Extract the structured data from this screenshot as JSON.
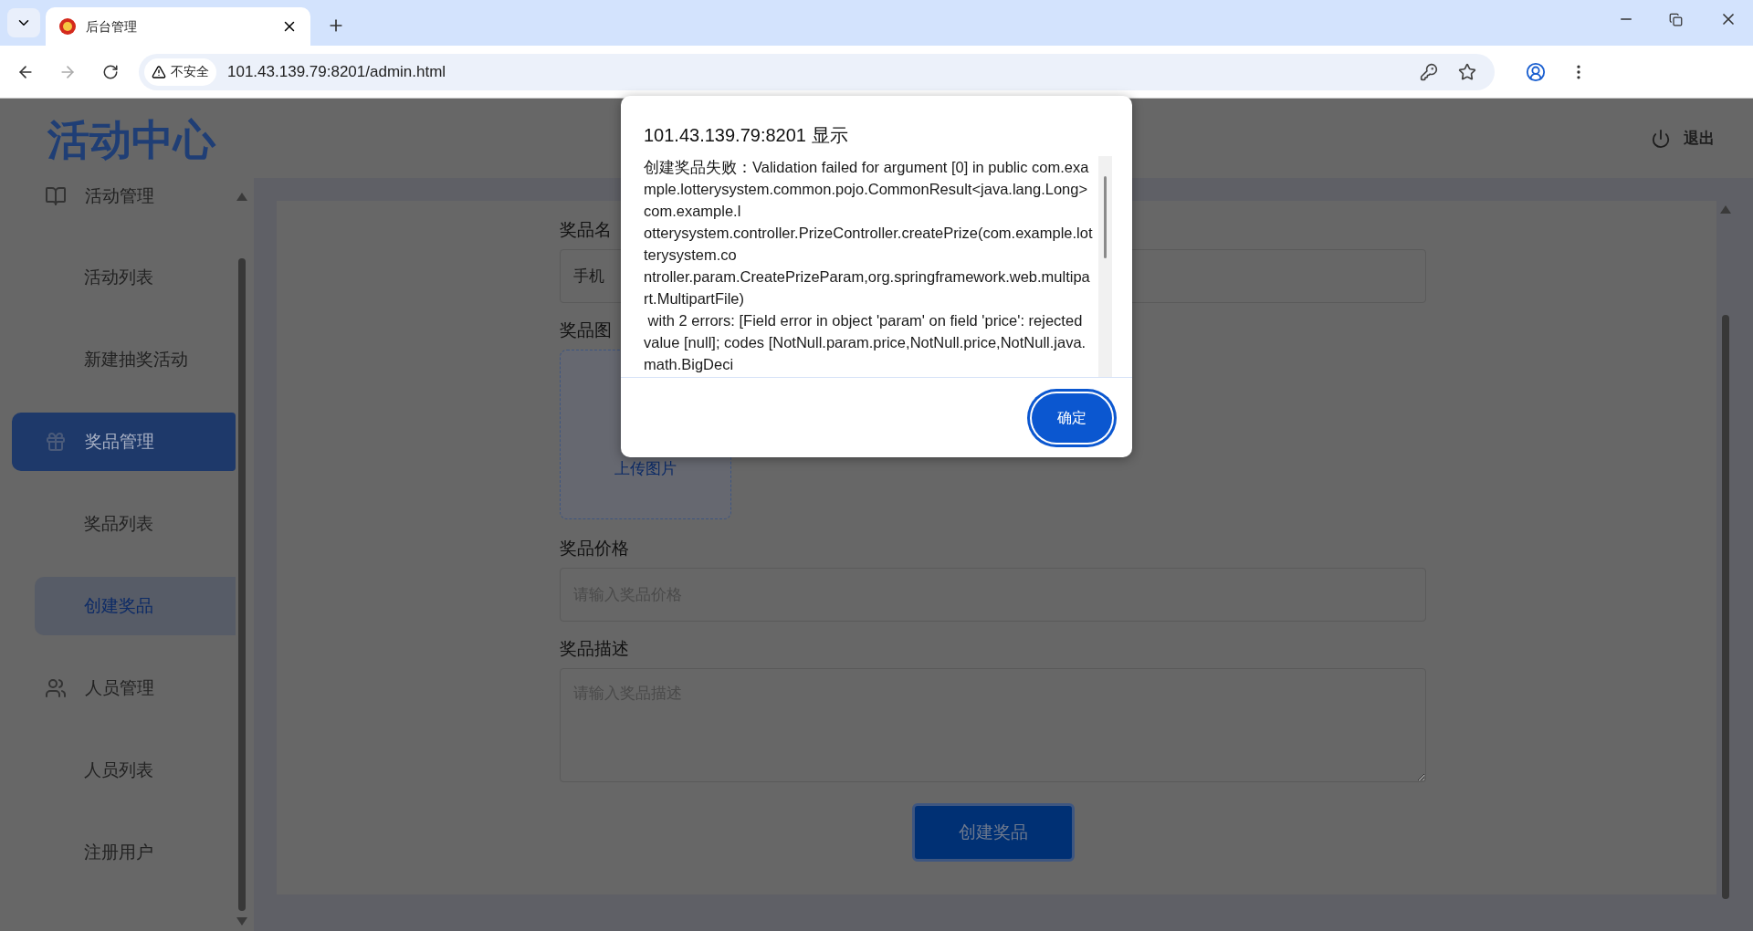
{
  "browser": {
    "tab_title": "后台管理",
    "security_label": "不安全",
    "url": "101.43.139.79:8201/admin.html"
  },
  "header": {
    "logo": "活动中心",
    "logout": "退出"
  },
  "sidebar": {
    "groups": [
      {
        "label": "活动管理",
        "selected": false,
        "children": [
          {
            "label": "活动列表",
            "selected": false
          },
          {
            "label": "新建抽奖活动",
            "selected": false
          }
        ]
      },
      {
        "label": "奖品管理",
        "selected": true,
        "children": [
          {
            "label": "奖品列表",
            "selected": false
          },
          {
            "label": "创建奖品",
            "selected": true
          }
        ]
      },
      {
        "label": "人员管理",
        "selected": false,
        "children": [
          {
            "label": "人员列表",
            "selected": false
          },
          {
            "label": "注册用户",
            "selected": false
          }
        ]
      }
    ]
  },
  "form": {
    "fields": [
      {
        "kind": "input",
        "label": "奖品名",
        "value": "手机"
      },
      {
        "kind": "upload",
        "label": "奖品图",
        "upload_text": "上传图片"
      },
      {
        "kind": "input",
        "label": "奖品价格",
        "placeholder": "请输入奖品价格"
      },
      {
        "kind": "textarea",
        "label": "奖品描述",
        "placeholder": "请输入奖品描述"
      }
    ],
    "submit": "创建奖品"
  },
  "dialog": {
    "title": "101.43.139.79:8201 显示",
    "message_lines": [
      "创建奖品失败：Validation failed for argument [0] in public com.example.lotterysystem.common.pojo.CommonResult<java.lang.Long> com.example.l",
      "otterysystem.controller.PrizeController.createPrize(com.example.lotterysystem.co",
      "ntroller.param.CreatePrizeParam,org.springframework.web.multipart.MultipartFile)",
      " with 2 errors: [Field error in object 'param' on field 'price': rejected value [null]; codes [NotNull.param.price,NotNull.price,NotNull.java.math.BigDeci"
    ],
    "ok": "确定"
  }
}
